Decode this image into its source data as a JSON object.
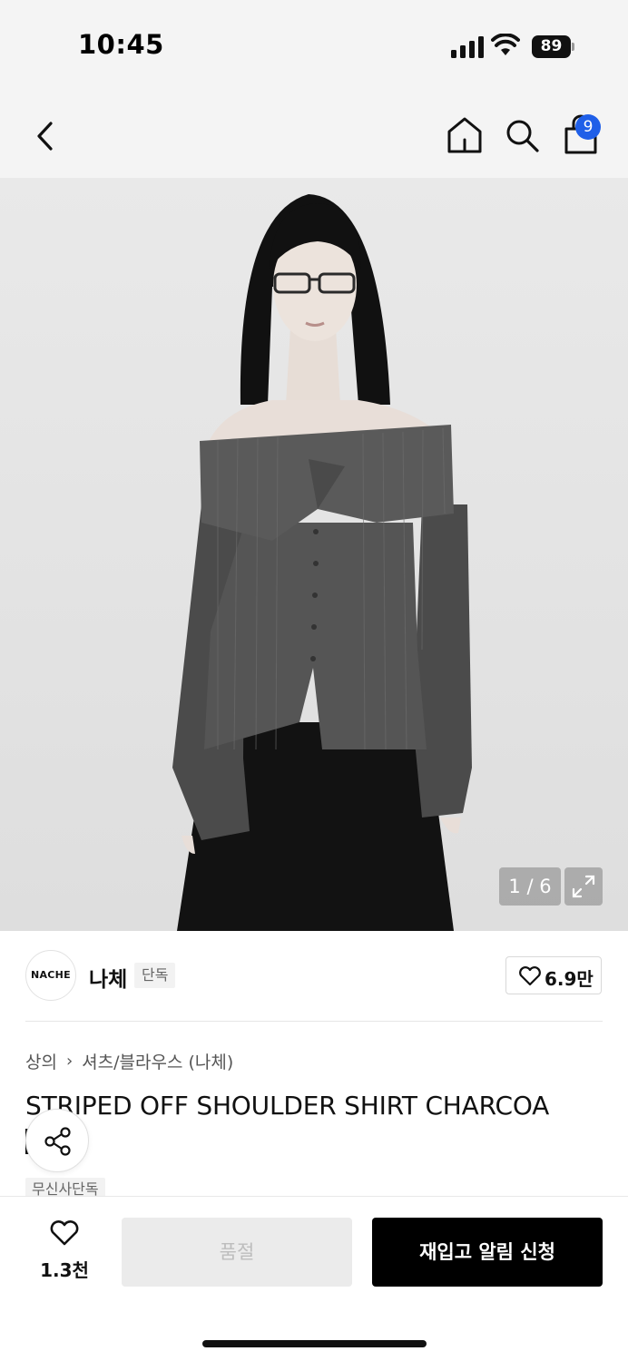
{
  "status_bar": {
    "time": "10:45",
    "battery": "89",
    "icons": [
      "signal-icon",
      "wifi-icon",
      "battery-icon"
    ]
  },
  "nav": {
    "icons": [
      "back-arrow-icon",
      "home-icon",
      "search-icon",
      "shopping-bag-icon"
    ],
    "cart_count": "9"
  },
  "gallery": {
    "counter": "1 / 6",
    "current": 1,
    "total": 6
  },
  "brand": {
    "logo_text": "NACHE",
    "name": "나체",
    "badge": "단독",
    "likes": "6.9만"
  },
  "breadcrumb": {
    "category": "상의",
    "subcategory": "셔츠/블라우스 (나체)"
  },
  "product": {
    "title": "STRIPED OFF SHOULDER SHIRT CHARCOA",
    "badge": "무신사단독"
  },
  "bottom_bar": {
    "likes": "1.3천",
    "soldout_label": "품절",
    "restock_label": "재입고 알림 신청"
  },
  "colors": {
    "accent": "#1f5fe8",
    "primary_button": "#000000",
    "disabled_button": "#ebebeb"
  }
}
